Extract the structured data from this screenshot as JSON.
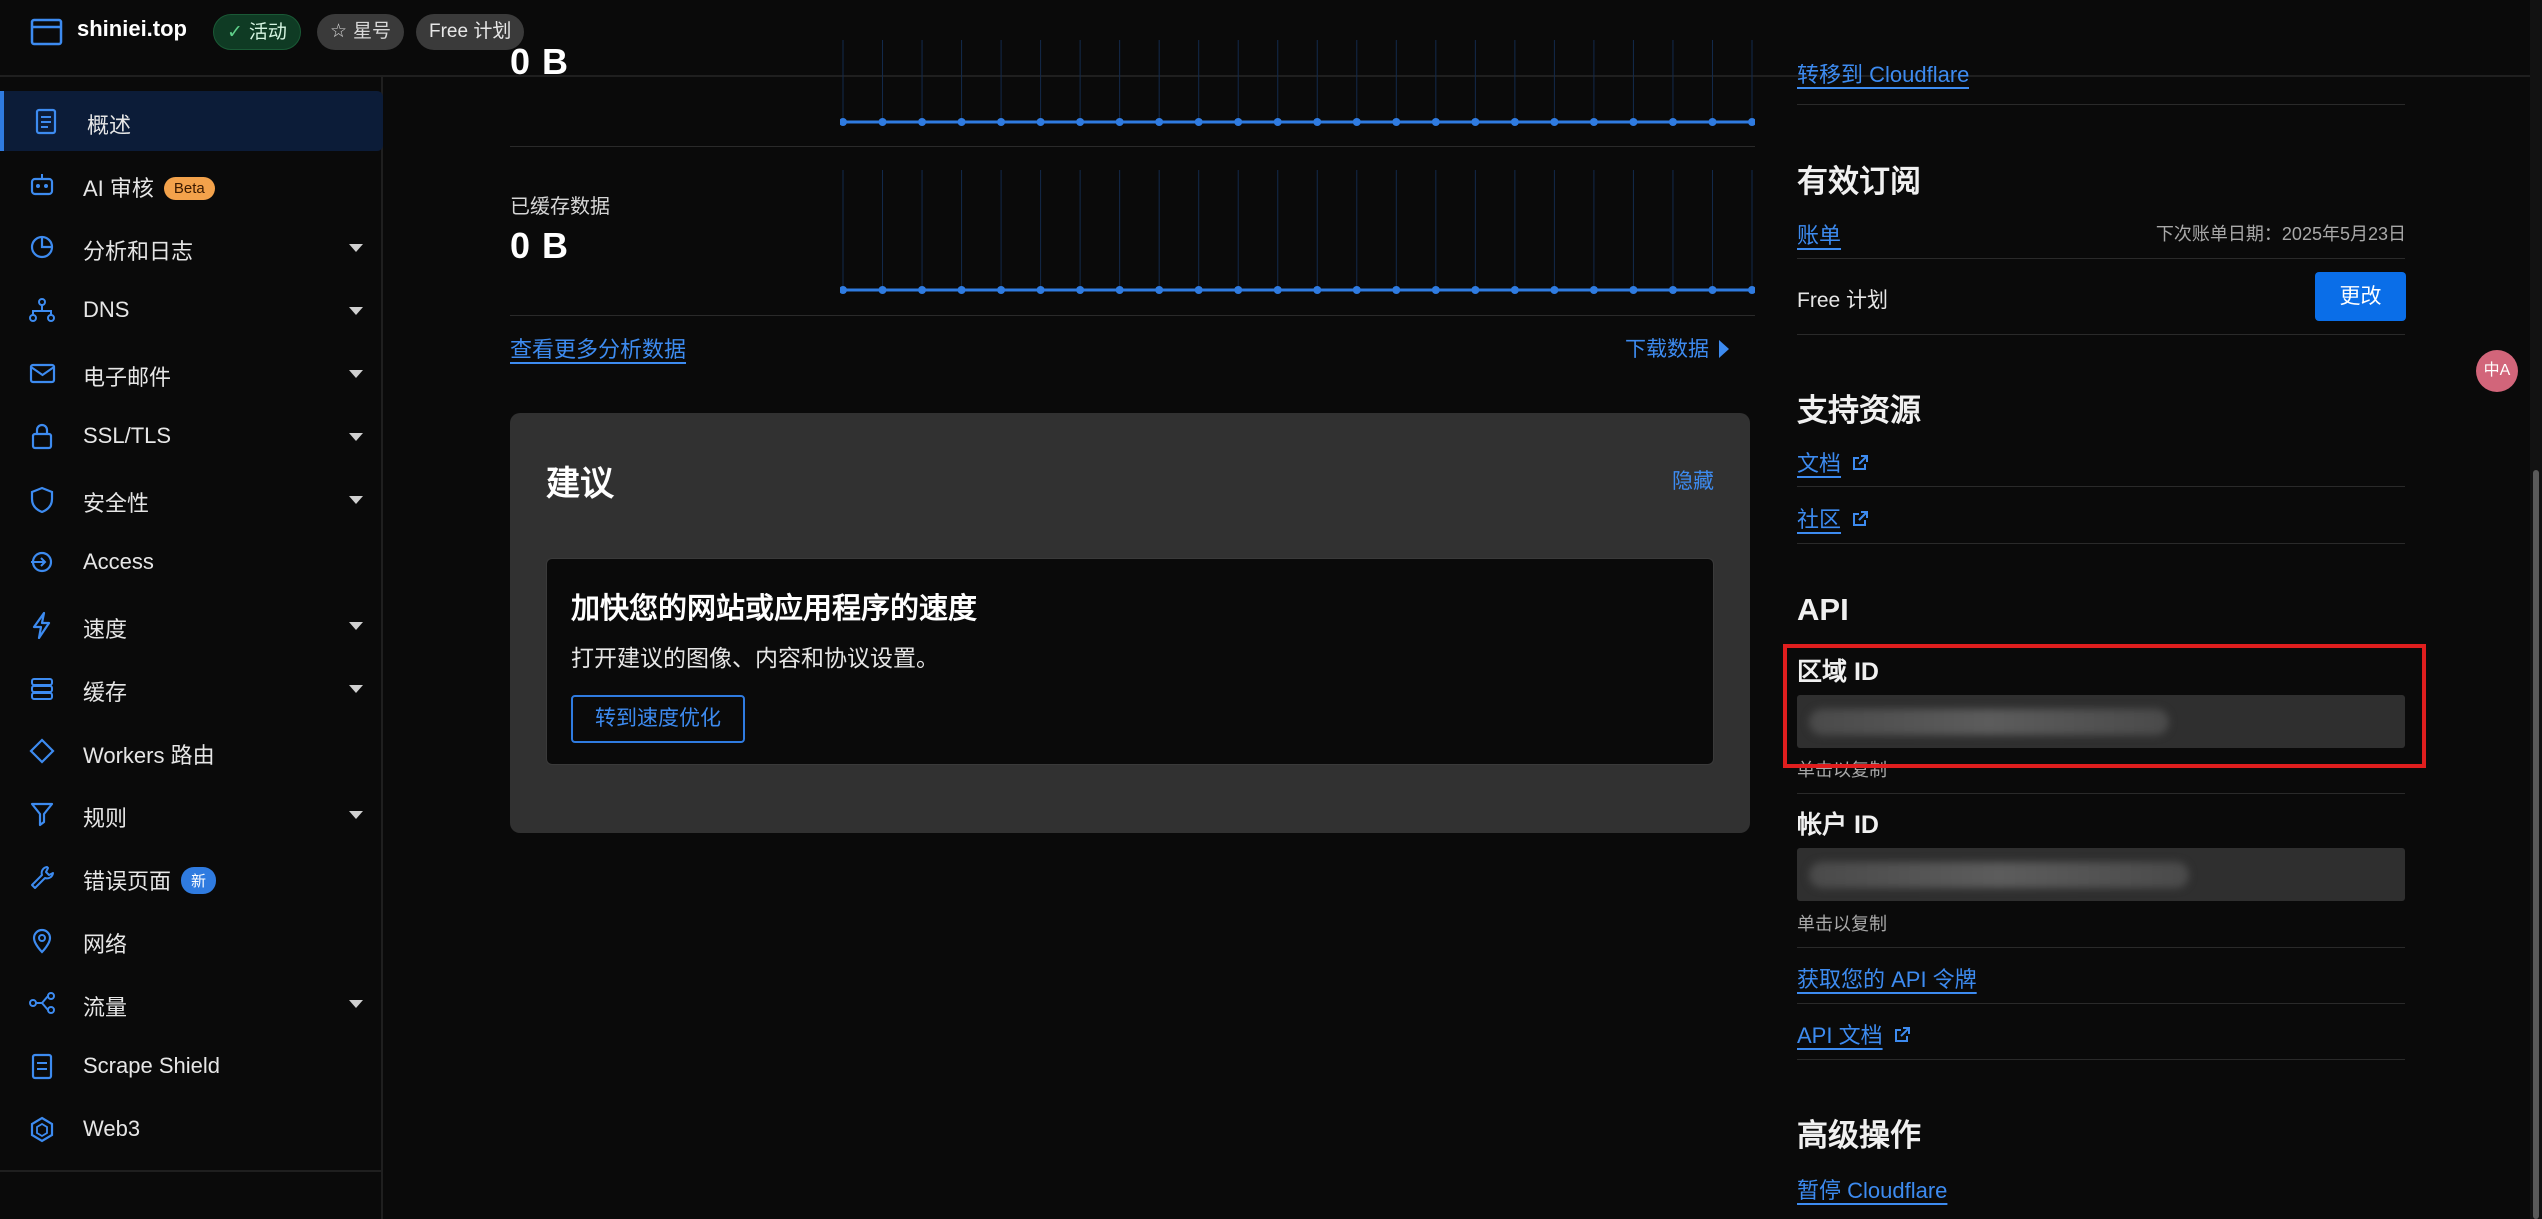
{
  "topbar": {
    "site_name": "shiniei.top",
    "status_pill": "活动",
    "star_pill": "星号",
    "plan_pill": "Free 计划"
  },
  "sidebar": {
    "items": [
      {
        "label": "概述",
        "icon": "document-icon",
        "active": true,
        "caret": false
      },
      {
        "label": "AI 审核",
        "icon": "robot-icon",
        "badge": "Beta",
        "caret": false
      },
      {
        "label": "分析和日志",
        "icon": "pie-chart-icon",
        "caret": true
      },
      {
        "label": "DNS",
        "icon": "network-icon",
        "caret": true
      },
      {
        "label": "电子邮件",
        "icon": "email-icon",
        "caret": true
      },
      {
        "label": "SSL/TLS",
        "icon": "lock-icon",
        "caret": true
      },
      {
        "label": "安全性",
        "icon": "shield-icon",
        "caret": true
      },
      {
        "label": "Access",
        "icon": "access-icon",
        "caret": false
      },
      {
        "label": "速度",
        "icon": "lightning-icon",
        "caret": true
      },
      {
        "label": "缓存",
        "icon": "database-icon",
        "caret": true
      },
      {
        "label": "Workers 路由",
        "icon": "workers-icon",
        "caret": false
      },
      {
        "label": "规则",
        "icon": "funnel-icon",
        "caret": true
      },
      {
        "label": "错误页面",
        "icon": "wrench-icon",
        "badge": "新",
        "caret": false
      },
      {
        "label": "网络",
        "icon": "location-pin-icon",
        "caret": false
      },
      {
        "label": "流量",
        "icon": "traffic-icon",
        "caret": true
      },
      {
        "label": "Scrape Shield",
        "icon": "scrape-shield-icon",
        "caret": false
      },
      {
        "label": "Web3",
        "icon": "web3-icon",
        "caret": false
      }
    ]
  },
  "analytics": {
    "top_value": "0 B",
    "cached_label": "已缓存数据",
    "cached_value": "0 B",
    "view_more": "查看更多分析数据",
    "download": "下载数据"
  },
  "suggestion": {
    "title": "建议",
    "hide": "隐藏",
    "card_title": "加快您的网站或应用程序的速度",
    "card_desc": "打开建议的图像、内容和协议设置。",
    "card_button": "转到速度优化"
  },
  "right": {
    "transfer_link": "转移到 Cloudflare",
    "subscription_title": "有效订阅",
    "billing_link": "账单",
    "next_bill": "下次账单日期：2025年5月23日",
    "plan_name": "Free 计划",
    "change_button": "更改",
    "support_title": "支持资源",
    "docs_link": "文档",
    "community_link": "社区",
    "api_title": "API",
    "zone_id_label": "区域 ID",
    "zone_copy_hint": "单击以复制",
    "account_id_label": "帐户 ID",
    "account_copy_hint": "单击以复制",
    "api_token_link": "获取您的 API 令牌",
    "api_docs_link": "API 文档",
    "advanced_title": "高级操作",
    "pause_link": "暂停 Cloudflare"
  },
  "translate_bubble": "中A",
  "colors": {
    "accent": "#3d8bf0",
    "primary_button": "#0a6ee8",
    "highlight_box": "#e01e1e",
    "active_pill": "#0f3b24",
    "beta_badge": "#f3a24b"
  }
}
